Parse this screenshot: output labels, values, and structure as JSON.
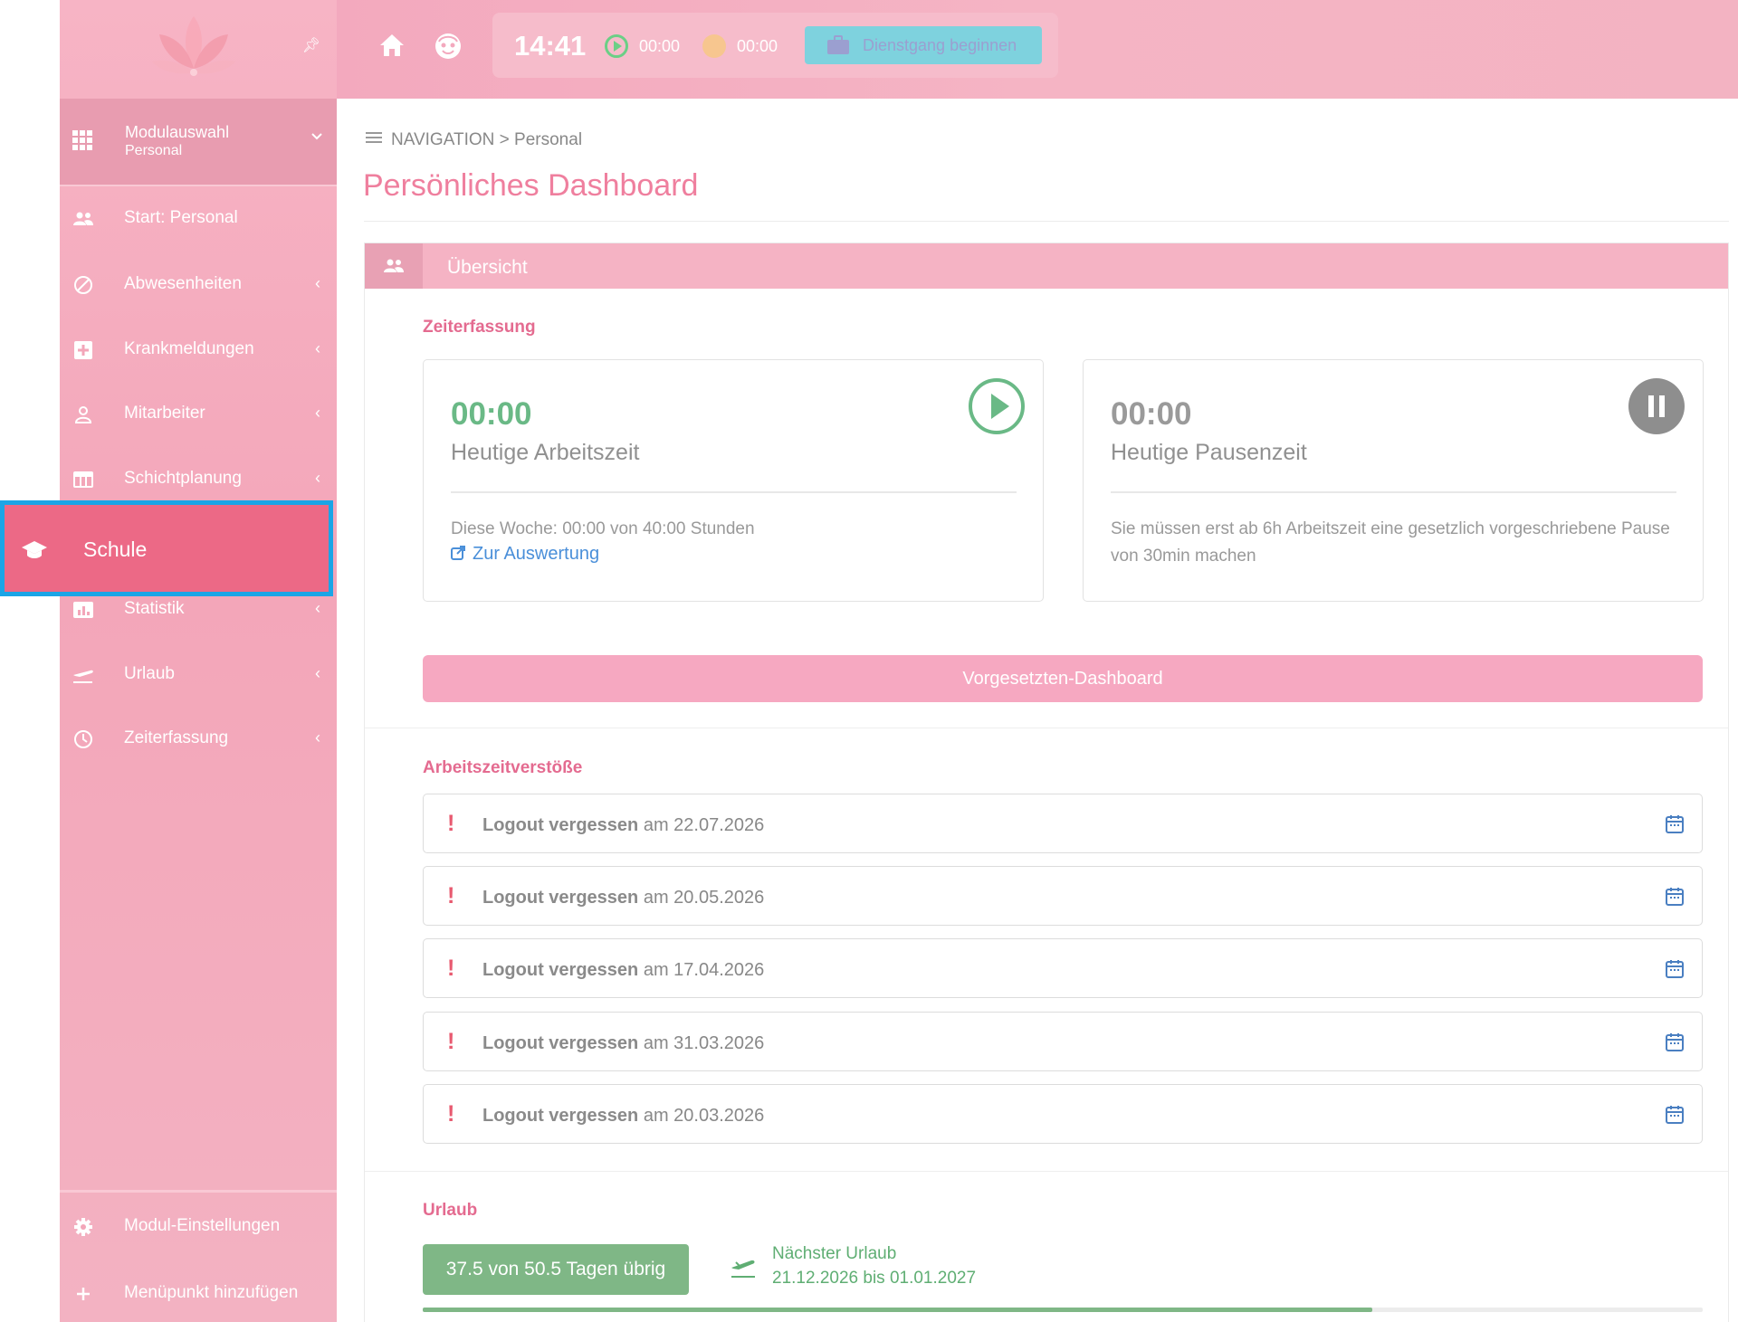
{
  "sidebar": {
    "module": {
      "title": "Modulauswahl",
      "subtitle": "Personal"
    },
    "items": [
      {
        "label": "Start: Personal",
        "icon": "users-icon",
        "has_arrow": false
      },
      {
        "label": "Abwesenheiten",
        "icon": "ban-icon",
        "has_arrow": true
      },
      {
        "label": "Krankmeldungen",
        "icon": "medical-plus-icon",
        "has_arrow": true
      },
      {
        "label": "Mitarbeiter",
        "icon": "user-icon",
        "has_arrow": true
      },
      {
        "label": "Schichtplanung",
        "icon": "table-icon",
        "has_arrow": true
      },
      {
        "label": "Schule",
        "icon": "graduation-cap-icon",
        "has_arrow": false,
        "highlighted": true
      },
      {
        "label": "Statistik",
        "icon": "chart-icon",
        "has_arrow": true
      },
      {
        "label": "Urlaub",
        "icon": "plane-icon",
        "has_arrow": true
      },
      {
        "label": "Zeiterfassung",
        "icon": "clock-icon",
        "has_arrow": true
      }
    ],
    "bottom": [
      {
        "label": "Modul-Einstellungen",
        "icon": "gear-icon"
      },
      {
        "label": "Menüpunkt hinzufügen",
        "icon": "plus-icon"
      }
    ],
    "arrow_glyph": "‹"
  },
  "topbar": {
    "clock": "14:41",
    "work_time": "00:00",
    "break_time": "00:00",
    "dienstgang_label": "Dienstgang beginnen"
  },
  "breadcrumb": {
    "root": "NAVIGATION",
    "separator": ">",
    "current": "Personal"
  },
  "page_title": "Persönliches Dashboard",
  "panel": {
    "header": "Übersicht",
    "zeiterfassung": {
      "title": "Zeiterfassung",
      "work": {
        "value": "00:00",
        "label": "Heutige Arbeitszeit",
        "week": "Diese Woche: 00:00 von 40:00 Stunden",
        "link": "Zur Auswertung"
      },
      "pause": {
        "value": "00:00",
        "label": "Heutige Pausenzeit",
        "note": "Sie müssen erst ab 6h Arbeitszeit eine gesetzlich vorgeschriebene Pause von 30min machen"
      }
    },
    "boss_button": "Vorgesetzten-Dashboard",
    "violations": {
      "title": "Arbeitszeitverstöße",
      "items": [
        {
          "bold": "Logout vergessen",
          "rest": "am 22.07.2026"
        },
        {
          "bold": "Logout vergessen",
          "rest": "am 20.05.2026"
        },
        {
          "bold": "Logout vergessen",
          "rest": "am 17.04.2026"
        },
        {
          "bold": "Logout vergessen",
          "rest": "am 31.03.2026"
        },
        {
          "bold": "Logout vergessen",
          "rest": "am 20.03.2026"
        }
      ]
    },
    "vacation": {
      "title": "Urlaub",
      "remaining": "37.5 von 50.5 Tagen übrig",
      "next_label": "Nächster Urlaub",
      "next_dates": "21.12.2026 bis 01.01.2027",
      "progress_fraction": 0.742
    }
  },
  "colors": {
    "accent_pink": "#ef7f9e",
    "highlight_border": "#1ba5e6",
    "success_green": "#7fb786",
    "link_blue": "#4a8fd9"
  }
}
